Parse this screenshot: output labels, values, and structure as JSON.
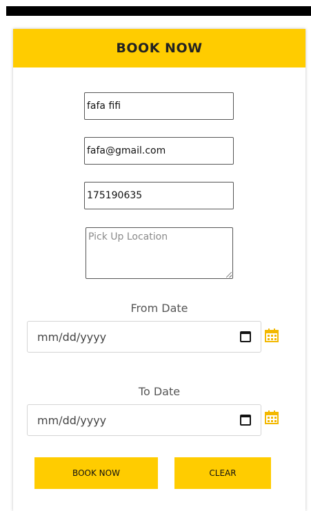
{
  "header": {
    "title": "BOOK NOW"
  },
  "form": {
    "name_value": "fafa fifi",
    "email_value": "fafa@gmail.com",
    "phone_value": "175190635",
    "pickup_placeholder": "Pick Up Location",
    "from_label": "From Date",
    "from_placeholder": "mm/dd/yyyy",
    "to_label": "To Date",
    "to_placeholder": "mm/dd/yyyy"
  },
  "buttons": {
    "book_label": "BOOK NOW",
    "clear_label": "CLEAR"
  },
  "colors": {
    "accent": "#ffcc00",
    "icon": "#f3b800"
  },
  "icons": [
    "calendar-icon",
    "calendar-icon"
  ]
}
